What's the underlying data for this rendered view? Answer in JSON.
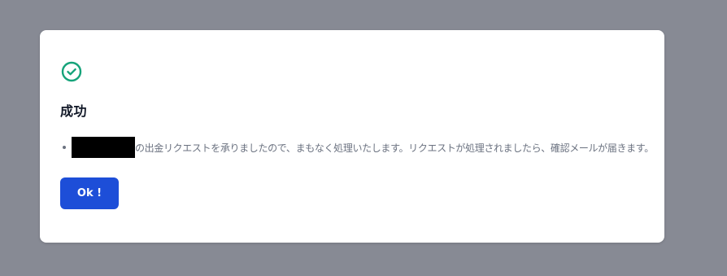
{
  "dialog": {
    "title": "成功",
    "message": "の出金リクエストを承りましたので、まもなく処理いたします。リクエストが処理されましたら、確認メールが届きます。",
    "ok_label": "Ok !"
  },
  "icons": {
    "status": "check-circle-icon"
  },
  "colors": {
    "backdrop": "#878a94",
    "success": "#16a37a",
    "primary_button": "#1d4ed8",
    "title": "#111827",
    "body_text": "#6b7280"
  }
}
